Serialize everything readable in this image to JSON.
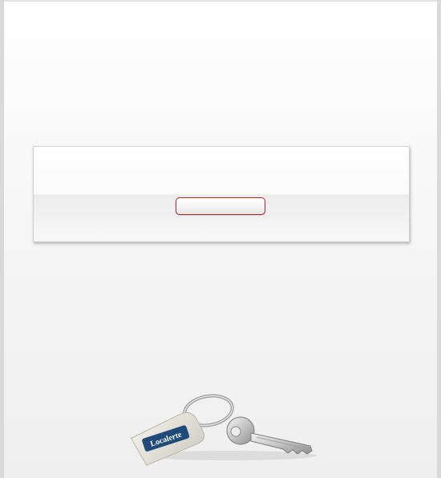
{
  "login_panel": {
    "button_label": ""
  },
  "keychain": {
    "brand_text": "Localerte",
    "icon": "key-chain-icon"
  },
  "colors": {
    "button_border": "#b02a2a",
    "tag_blue": "#1f4a7a",
    "background": "#f4f4f4"
  }
}
